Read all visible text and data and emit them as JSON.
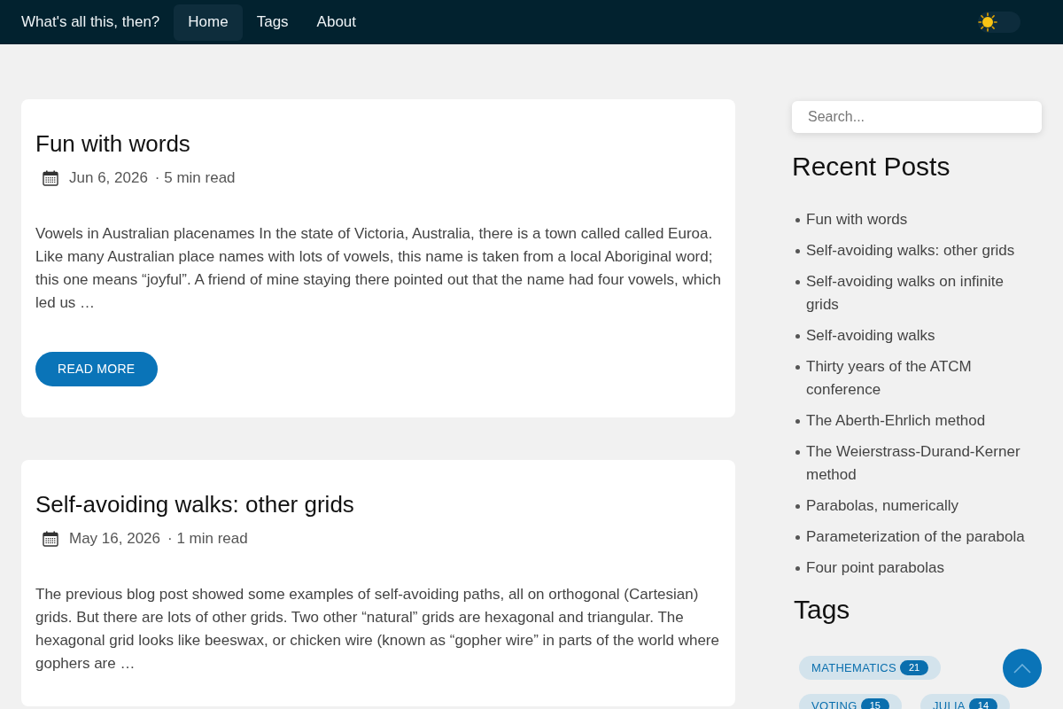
{
  "navbar": {
    "brand": "What's all this, then?",
    "links": [
      {
        "label": "Home",
        "selected": true
      },
      {
        "label": "Tags",
        "selected": false
      },
      {
        "label": "About",
        "selected": false
      }
    ],
    "theme_toggle": {
      "dark_mode": false
    }
  },
  "posts": [
    {
      "title": "Fun with words",
      "date": "Jun 6, 2026",
      "reading": "· 5 min read",
      "excerpt": "Vowels in Australian placenames In the state of Victoria, Australia, there is a town called called Euroa. Like many Australian place names with lots of vowels, this name is taken from a local Aboriginal word; this one means “joyful”. A friend of mine staying there pointed out that the name had four vowels, which led us …",
      "button": "READ MORE"
    },
    {
      "title": "Self-avoiding walks: other grids",
      "date": "May 16, 2026",
      "reading": "· 1 min read",
      "excerpt": "The previous blog post showed some examples of self-avoiding paths, all on orthogonal (Cartesian) grids. But there are lots of other grids. Two other “natural” grids are hexagonal and triangular. The hexagonal grid looks like beeswax, or chicken wire (known as “gopher wire” in parts of the world where gophers are …"
    }
  ],
  "sidebar": {
    "search": {
      "placeholder": "Search..."
    },
    "recent_posts": {
      "title": "Recent Posts",
      "items": [
        "Fun with words",
        "Self-avoiding walks: other grids",
        "Self-avoiding walks on infinite grids",
        "Self-avoiding walks",
        "Thirty years of the ATCM conference",
        "The Aberth-Ehrlich method",
        "The Weierstrass-Durand-Kerner method",
        "Parabolas, numerically",
        "Parameterization of the parabola",
        "Four point parabolas"
      ]
    },
    "tags": {
      "title": "Tags",
      "items": [
        {
          "label": "MATHEMATICS",
          "count": "21"
        },
        {
          "label": "VOTING",
          "count": "15"
        },
        {
          "label": "JULIA",
          "count": "14"
        }
      ]
    }
  }
}
